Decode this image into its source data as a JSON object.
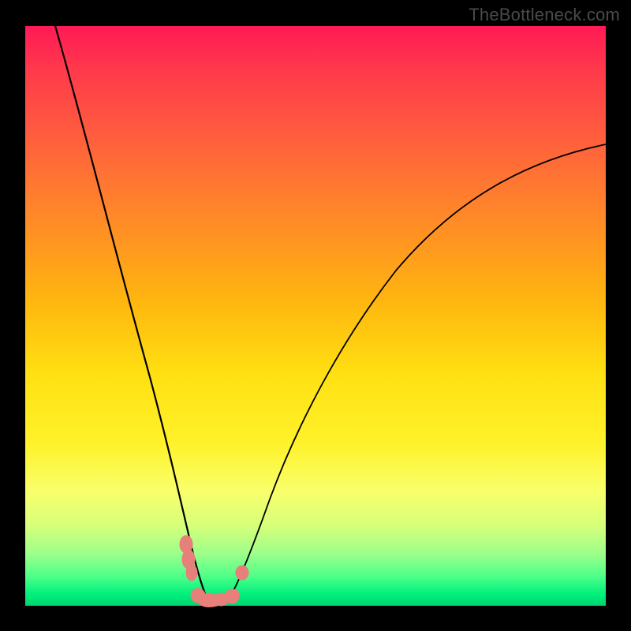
{
  "watermark": "TheBottleneck.com",
  "chart_data": {
    "type": "line",
    "title": "",
    "xlabel": "",
    "ylabel": "",
    "xlim": [
      0,
      100
    ],
    "ylim": [
      0,
      100
    ],
    "grid": false,
    "legend": false,
    "series": [
      {
        "name": "left-curve",
        "x": [
          5,
          10,
          15,
          20,
          22,
          24,
          26,
          27,
          28,
          29,
          30
        ],
        "values": [
          100,
          80,
          57,
          33,
          23,
          14,
          7,
          4,
          2,
          0.6,
          0
        ]
      },
      {
        "name": "right-curve",
        "x": [
          34,
          36,
          38,
          42,
          48,
          56,
          66,
          78,
          90,
          100
        ],
        "values": [
          0,
          3,
          8,
          18,
          30,
          42,
          54,
          64,
          73,
          79
        ]
      }
    ],
    "markers": [
      {
        "name": "blob-left-upper",
        "x": 27.0,
        "y": 6.0
      },
      {
        "name": "blob-left-lower",
        "x": 27.3,
        "y": 3.0
      },
      {
        "name": "blob-bottom-1",
        "x": 29.0,
        "y": 0.5
      },
      {
        "name": "blob-bottom-2",
        "x": 30.5,
        "y": 0.3
      },
      {
        "name": "blob-bottom-3",
        "x": 32.5,
        "y": 0.3
      },
      {
        "name": "blob-bottom-4",
        "x": 34.0,
        "y": 0.7
      },
      {
        "name": "blob-right",
        "x": 36.5,
        "y": 5.0
      }
    ],
    "marker_color": "#e77f7a",
    "background_gradient": {
      "top": "#ff1a55",
      "middle": "#fff22a",
      "bottom": "#00d46e"
    }
  }
}
